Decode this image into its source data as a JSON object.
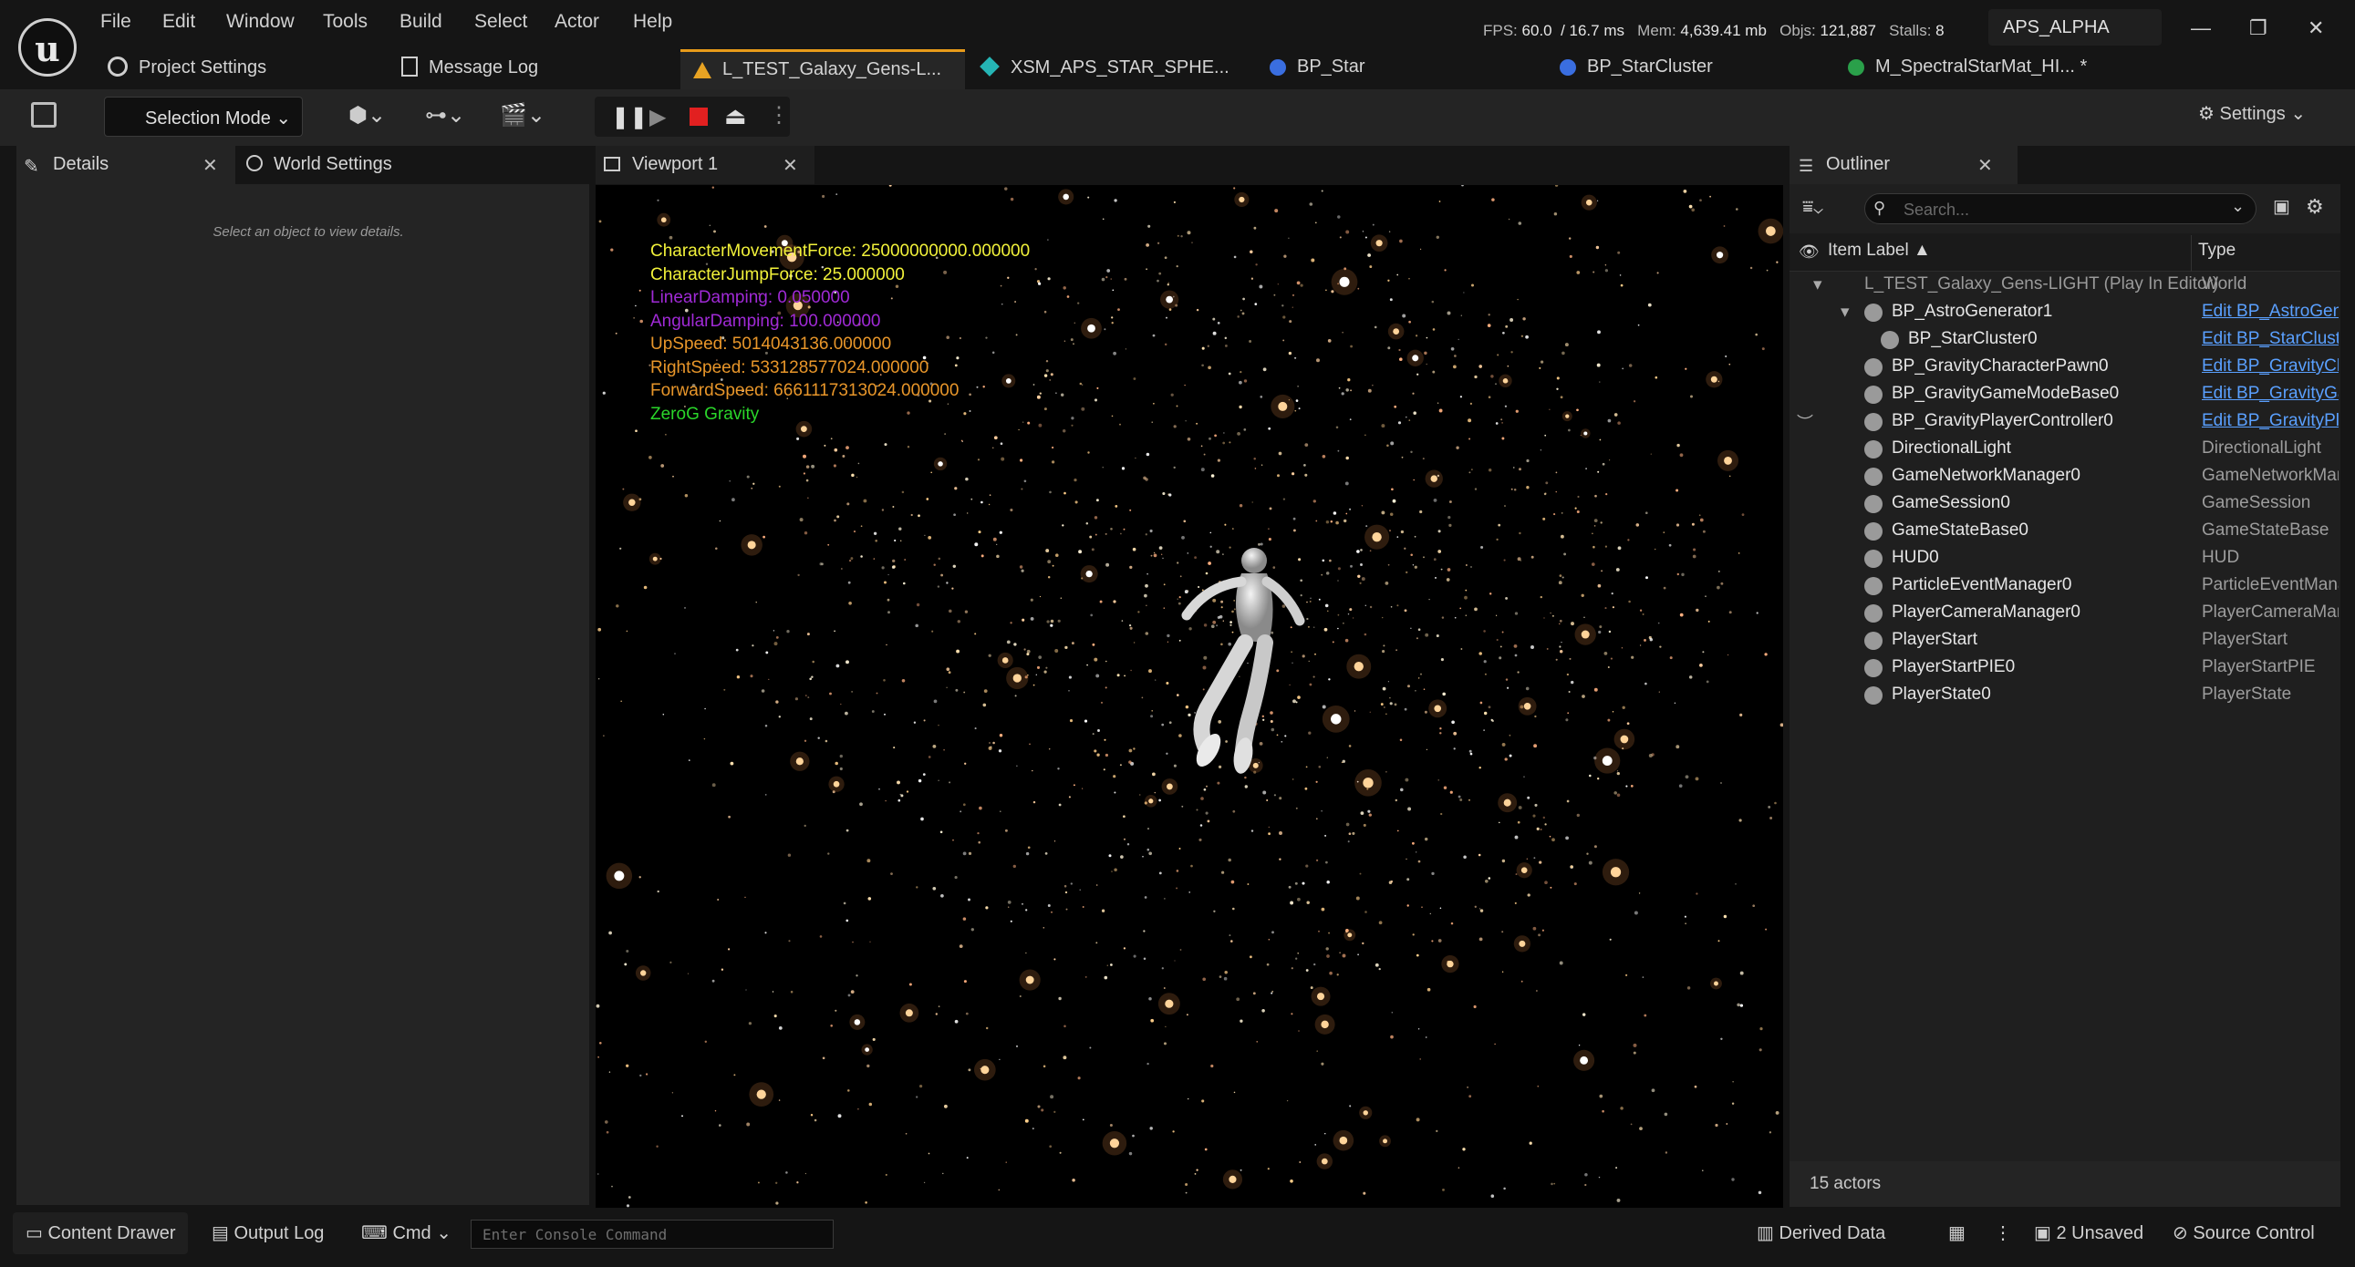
{
  "menu": [
    "File",
    "Edit",
    "Window",
    "Tools",
    "Build",
    "Select",
    "Actor",
    "Help"
  ],
  "stats": {
    "fps_label": "FPS:",
    "fps": "60.0",
    "ms": "/ 16.7 ms",
    "mem_label": "Mem:",
    "mem": "4,639.41 mb",
    "objs_label": "Objs:",
    "objs": "121,887",
    "stalls_label": "Stalls:",
    "stalls": "8"
  },
  "app_name": "APS_ALPHA",
  "top_tabs": {
    "project_settings": "Project Settings",
    "message_log": "Message Log"
  },
  "doc_tabs": [
    "L_TEST_Galaxy_Gens-L...",
    "XSM_APS_STAR_SPHE...",
    "BP_Star",
    "BP_StarCluster",
    "M_SpectralStarMat_HI... *"
  ],
  "toolbar": {
    "selection_mode": "Selection Mode",
    "settings": "Settings"
  },
  "panels": {
    "details": "Details",
    "world_settings": "World Settings",
    "viewport": "Viewport 1",
    "outliner": "Outliner",
    "details_hint": "Select an object to view details."
  },
  "hud": [
    {
      "text": "CharacterMovementForce: 25000000000.000000",
      "color": "#f2f23a"
    },
    {
      "text": "CharacterJumpForce: 25.000000",
      "color": "#f2f23a"
    },
    {
      "text": "LinearDamping: 0.050000",
      "color": "#a02ad6"
    },
    {
      "text": "AngularDamping: 100.000000",
      "color": "#a02ad6"
    },
    {
      "text": "UpSpeed: 5014043136.000000",
      "color": "#e8962a"
    },
    {
      "text": "RightSpeed: 533128577024.000000",
      "color": "#e8962a"
    },
    {
      "text": "ForwardSpeed: 6661117313024.000000",
      "color": "#e8962a"
    },
    {
      "text": "ZeroG Gravity",
      "color": "#2ad62a"
    }
  ],
  "outliner": {
    "search_placeholder": "Search...",
    "col_label": "Item Label ▲",
    "col_type": "Type",
    "rows": [
      {
        "label": "L_TEST_Galaxy_Gens-LIGHT (Play In Editor)",
        "type": "World",
        "link": false
      },
      {
        "label": "BP_AstroGenerator1",
        "type": "Edit BP_AstroGenerator",
        "link": true
      },
      {
        "label": "BP_StarCluster0",
        "type": "Edit BP_StarCluster",
        "link": true
      },
      {
        "label": "BP_GravityCharacterPawn0",
        "type": "Edit BP_GravityCharacterPawn",
        "link": true
      },
      {
        "label": "BP_GravityGameModeBase0",
        "type": "Edit BP_GravityGameModeBase",
        "link": true
      },
      {
        "label": "BP_GravityPlayerController0",
        "type": "Edit BP_GravityPlayerController",
        "link": true
      },
      {
        "label": "DirectionalLight",
        "type": "DirectionalLight",
        "link": false
      },
      {
        "label": "GameNetworkManager0",
        "type": "GameNetworkManager",
        "link": false
      },
      {
        "label": "GameSession0",
        "type": "GameSession",
        "link": false
      },
      {
        "label": "GameStateBase0",
        "type": "GameStateBase",
        "link": false
      },
      {
        "label": "HUD0",
        "type": "HUD",
        "link": false
      },
      {
        "label": "ParticleEventManager0",
        "type": "ParticleEventManager",
        "link": false
      },
      {
        "label": "PlayerCameraManager0",
        "type": "PlayerCameraManager",
        "link": false
      },
      {
        "label": "PlayerStart",
        "type": "PlayerStart",
        "link": false
      },
      {
        "label": "PlayerStartPIE0",
        "type": "PlayerStartPIE",
        "link": false
      },
      {
        "label": "PlayerState0",
        "type": "PlayerState",
        "link": false
      }
    ],
    "footer": "15 actors"
  },
  "bottom": {
    "content_drawer": "Content Drawer",
    "output_log": "Output Log",
    "cmd": "Cmd",
    "console_placeholder": "Enter Console Command",
    "derived_data": "Derived Data",
    "unsaved": "2 Unsaved",
    "source_control": "Source Control"
  },
  "colors": {
    "accent_tab": "#e89b1a",
    "link": "#5aa0ff",
    "stop": "#e22020"
  }
}
